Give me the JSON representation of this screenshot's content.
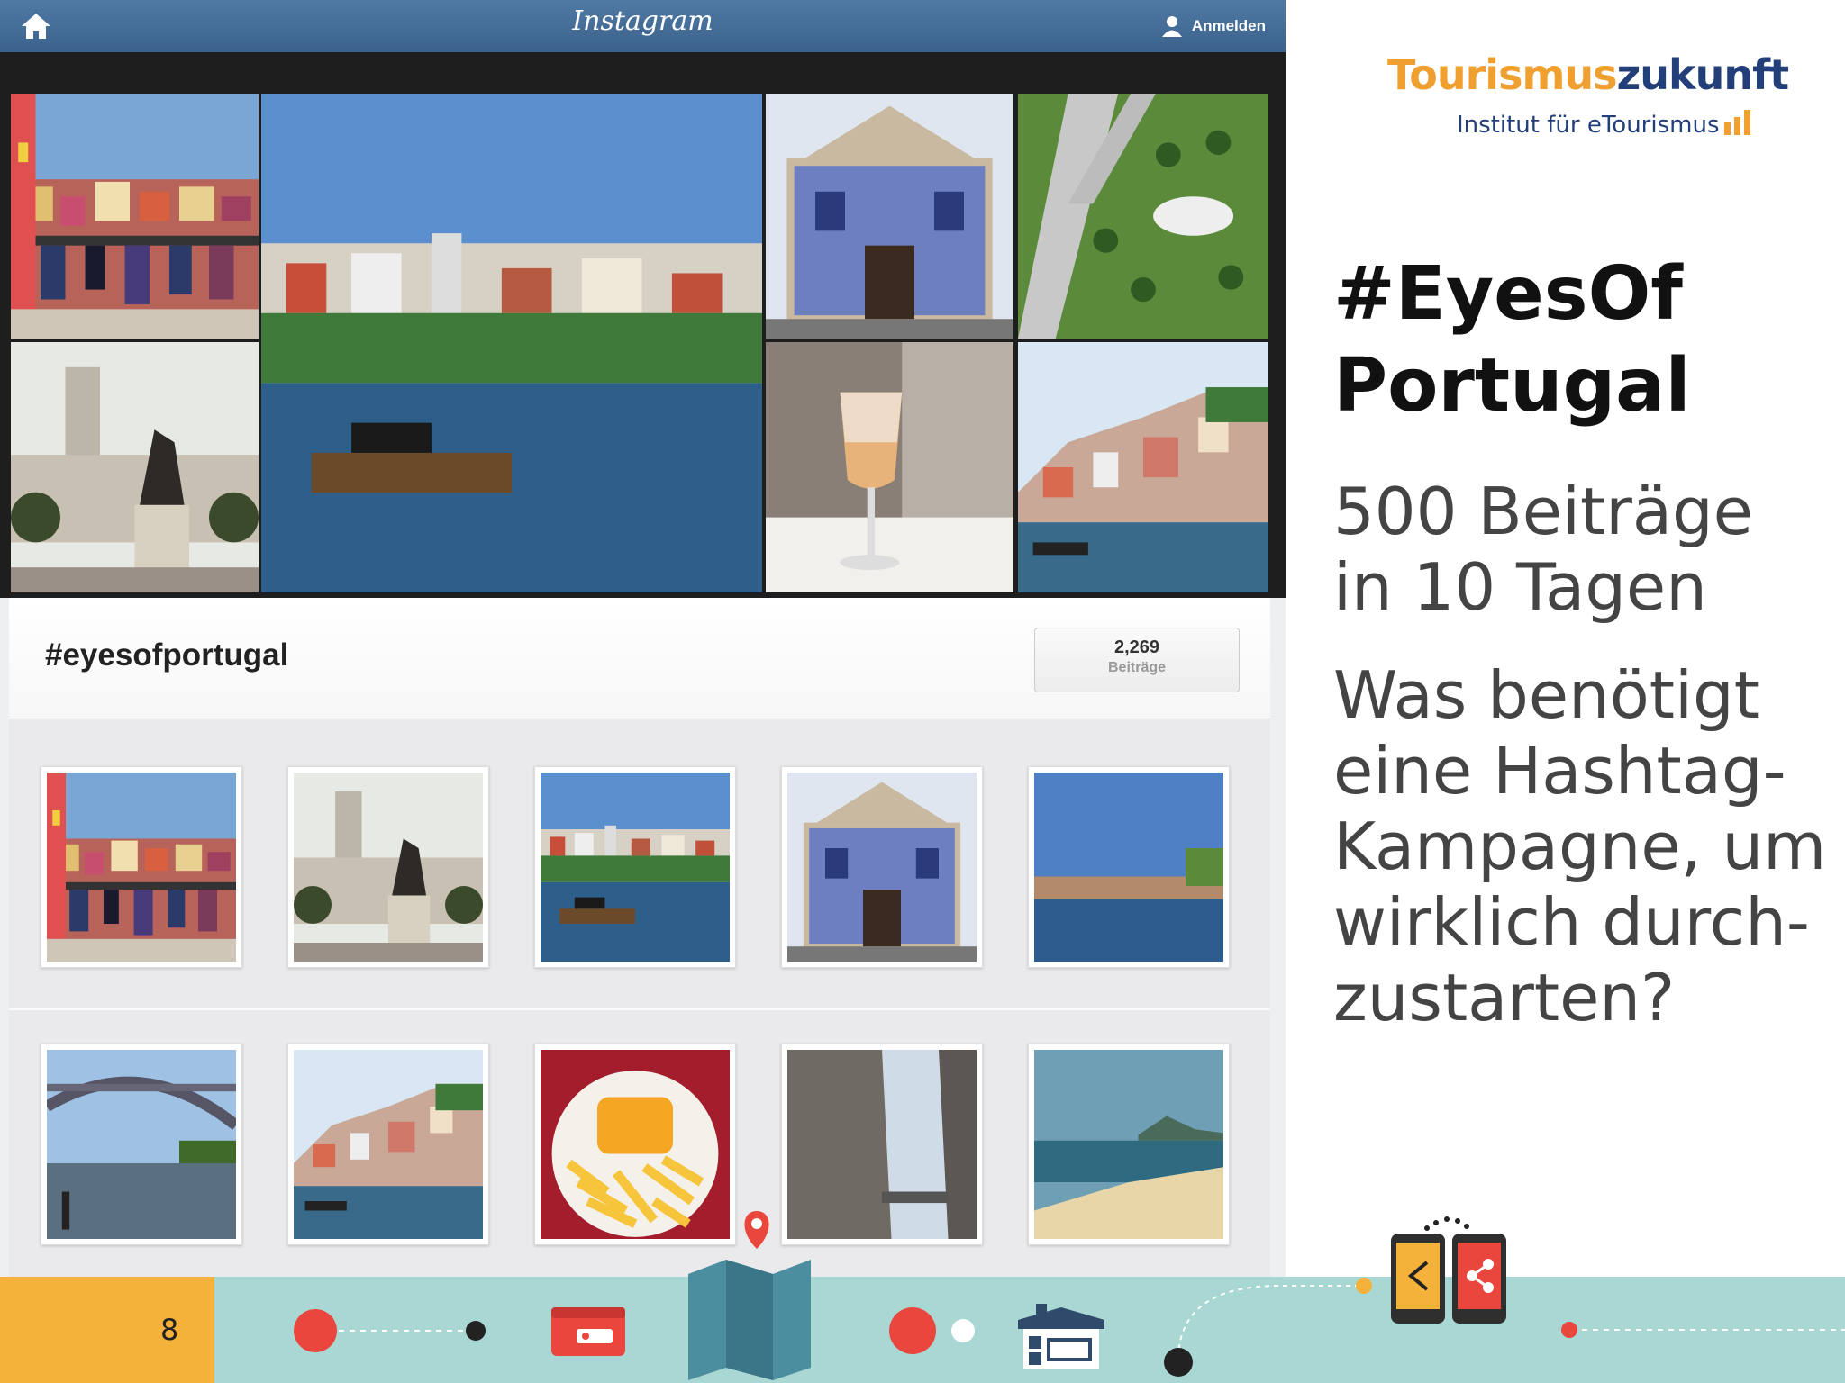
{
  "instagram": {
    "logo": "Instagram",
    "login_label": "Anmelden",
    "hashtag": "#eyesofportugal",
    "post_count": "2,269",
    "post_count_label": "Beiträge"
  },
  "slide": {
    "brand_part1": "Tourismus",
    "brand_part2": "zukunft",
    "brand_subtitle": "Institut für eTourismus",
    "title_line1": "#EyesOf",
    "title_line2": "Portugal",
    "stat_line1": "500 Beiträge",
    "stat_line2": "in 10 Tagen",
    "question_line1": "Was benötigt",
    "question_line2": "eine Hashtag-",
    "question_line3": "Kampagne, um",
    "question_line4": "wirklich durch-",
    "question_line5": "zustarten?",
    "page_number": "8"
  },
  "colors": {
    "instagram_bar": "#3f6891",
    "brand_orange": "#f0a030",
    "brand_blue": "#233f7a",
    "footer_teal": "#a9d7d4",
    "footer_yellow": "#f4b23b",
    "footer_red": "#e9463e"
  },
  "icons": [
    "home-icon",
    "user-icon",
    "signal-bars-icon",
    "dot-icon",
    "wallet-icon",
    "map-icon",
    "map-pin-icon",
    "house-icon",
    "share-icon",
    "phone-icon"
  ]
}
